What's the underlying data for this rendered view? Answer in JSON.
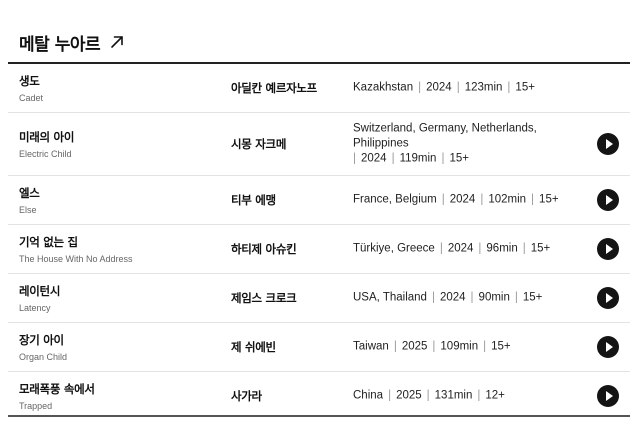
{
  "section": {
    "title": "메탈 누아르",
    "link_icon": "arrow-up-right-icon"
  },
  "colors": {
    "text": "#111111",
    "subtext": "#666666",
    "play_button": "#141414",
    "divider": "#e3e3e3"
  },
  "films": [
    {
      "title_ko": "생도",
      "title_en": "Cadet",
      "director": "아딜칸 예르자노프",
      "countries": "Kazakhstan",
      "year": "2024",
      "runtime": "123min",
      "rating": "15+",
      "has_play": false
    },
    {
      "title_ko": "미래의 아이",
      "title_en": "Electric Child",
      "director": "시몽 자크메",
      "countries": "Switzerland, Germany, Netherlands, Philippines",
      "year": "2024",
      "runtime": "119min",
      "rating": "15+",
      "has_play": true
    },
    {
      "title_ko": "엘스",
      "title_en": "Else",
      "director": "티부 에맹",
      "countries": "France, Belgium",
      "year": "2024",
      "runtime": "102min",
      "rating": "15+",
      "has_play": true
    },
    {
      "title_ko": "기억 없는 집",
      "title_en": "The House With No Address",
      "director": "하티제 아슈킨",
      "countries": "Türkiye, Greece",
      "year": "2024",
      "runtime": "96min",
      "rating": "15+",
      "has_play": true
    },
    {
      "title_ko": "레이턴시",
      "title_en": "Latency",
      "director": "제임스 크로크",
      "countries": "USA, Thailand",
      "year": "2024",
      "runtime": "90min",
      "rating": "15+",
      "has_play": true
    },
    {
      "title_ko": "장기 아이",
      "title_en": "Organ Child",
      "director": "제 쉬에빈",
      "countries": "Taiwan",
      "year": "2025",
      "runtime": "109min",
      "rating": "15+",
      "has_play": true
    },
    {
      "title_ko": "모래폭풍 속에서",
      "title_en": "Trapped",
      "director": "사가라",
      "countries": "China",
      "year": "2025",
      "runtime": "131min",
      "rating": "12+",
      "has_play": true
    }
  ]
}
